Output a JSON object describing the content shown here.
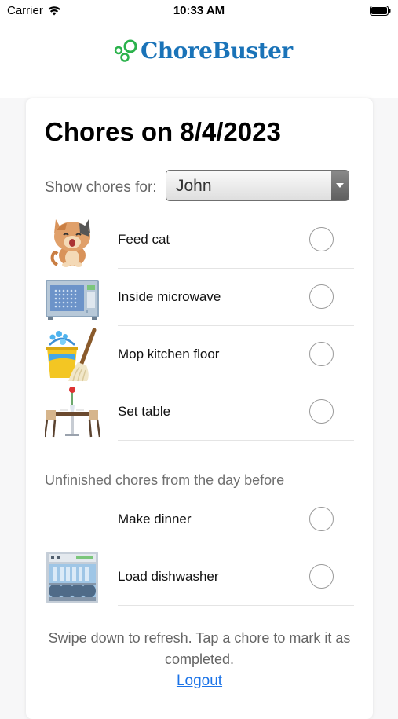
{
  "status_bar": {
    "carrier": "Carrier",
    "time": "10:33 AM"
  },
  "header": {
    "logo_text": "ChoreBuster",
    "logo_icon": "bubbles-icon"
  },
  "page": {
    "title": "Chores on 8/4/2023"
  },
  "filter": {
    "label": "Show chores for:",
    "selected": "John"
  },
  "today_chores": [
    {
      "name": "Feed cat",
      "icon": "cat-icon"
    },
    {
      "name": "Inside microwave",
      "icon": "microwave-icon"
    },
    {
      "name": "Mop kitchen floor",
      "icon": "mop-bucket-icon"
    },
    {
      "name": "Set table",
      "icon": "dining-table-icon"
    }
  ],
  "unfinished": {
    "title": "Unfinished chores from the day before",
    "chores": [
      {
        "name": "Make dinner",
        "icon": ""
      },
      {
        "name": "Load dishwasher",
        "icon": "dishwasher-icon"
      }
    ]
  },
  "footer": {
    "hint": "Swipe down to refresh. Tap a chore to mark it as completed.",
    "logout": "Logout"
  },
  "colors": {
    "brand": "#1a73b8",
    "logo_green": "#2bb24c",
    "link": "#1a73e8"
  }
}
